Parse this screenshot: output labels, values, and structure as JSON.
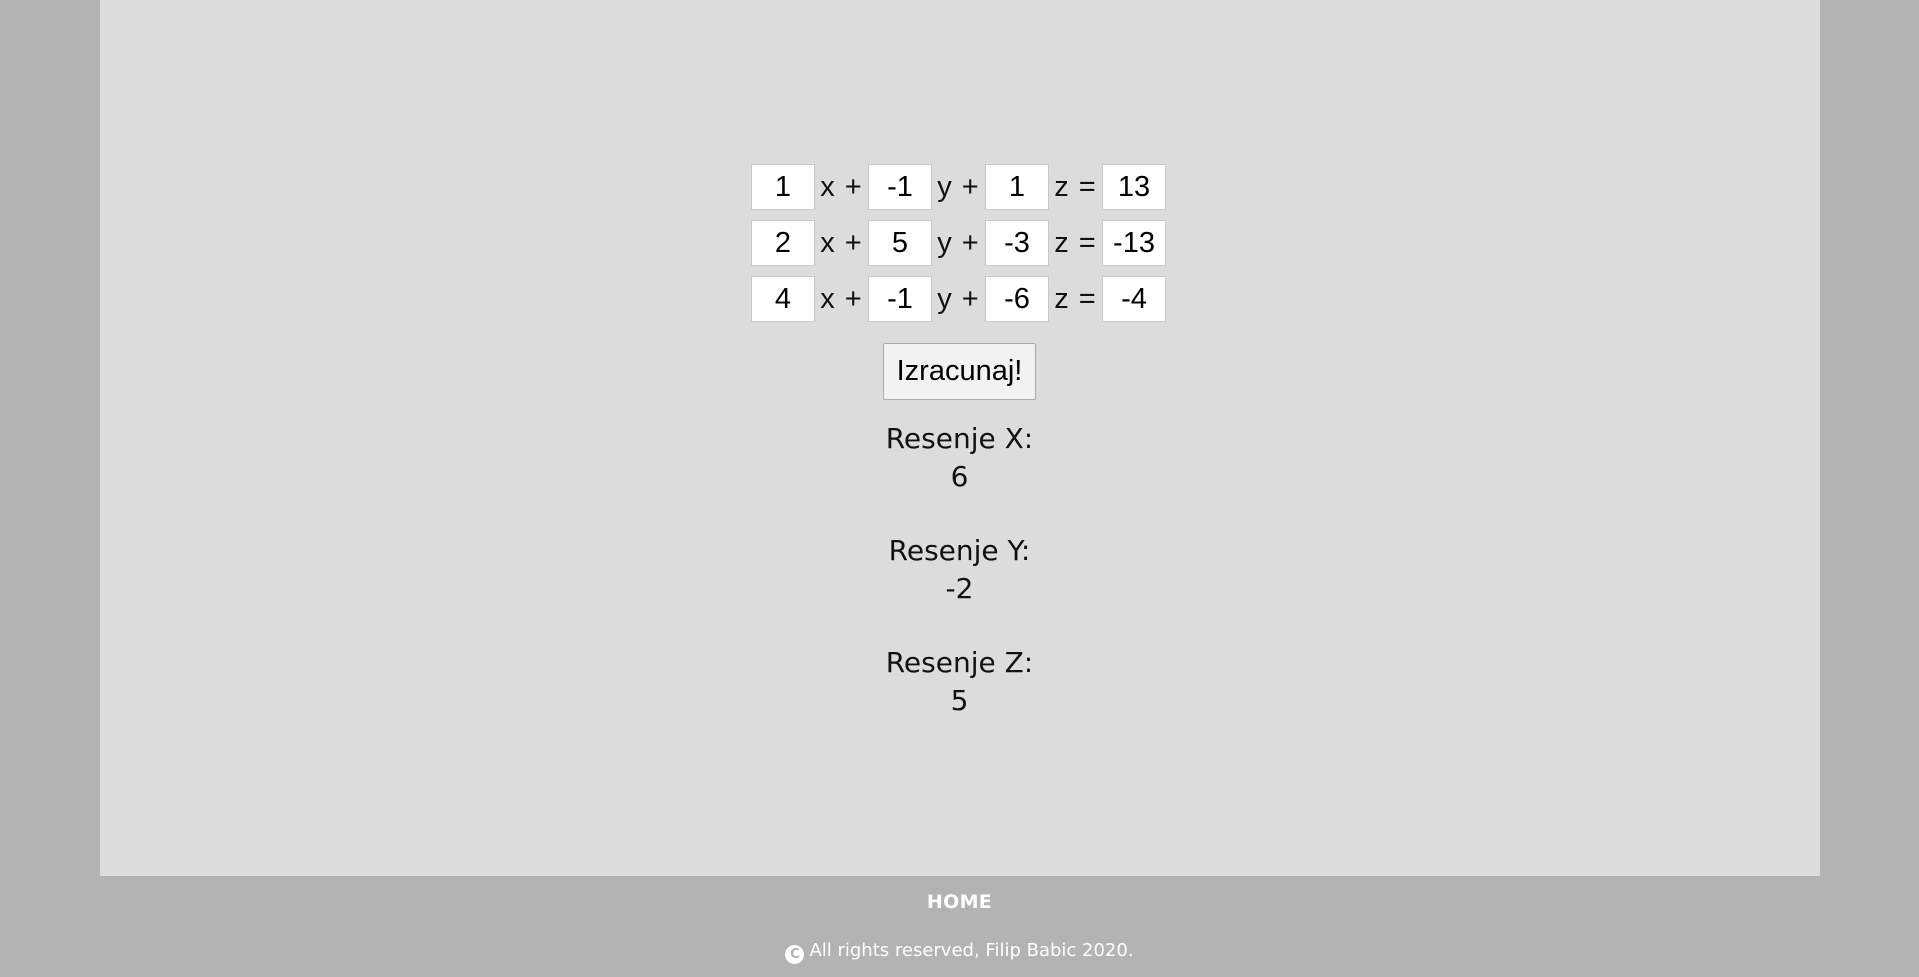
{
  "equations": [
    {
      "a": "1",
      "b": "-1",
      "c": "1",
      "d": "13"
    },
    {
      "a": "2",
      "b": "5",
      "c": "-3",
      "d": "-13"
    },
    {
      "a": "4",
      "b": "-1",
      "c": "-6",
      "d": "-4"
    }
  ],
  "var_labels": {
    "x": "x +",
    "y": "y +",
    "z": "z ="
  },
  "calculate_button": "Izracunaj!",
  "results": {
    "x_label": "Resenje X:",
    "x_value": "6",
    "y_label": "Resenje Y:",
    "y_value": "-2",
    "z_label": "Resenje Z:",
    "z_value": "5"
  },
  "footer": {
    "home": "HOME",
    "copyright_symbol": "C",
    "copyright": "All rights reserved, Filip Babic 2020."
  },
  "colors": {
    "outer_background": "#b3b3b3",
    "panel_background": "#dcdcdc",
    "footer_text": "#ffffff"
  }
}
